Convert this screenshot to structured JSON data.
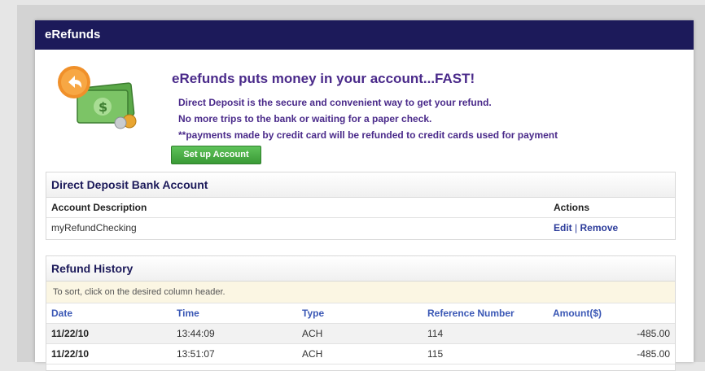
{
  "window": {
    "title": "eRefunds"
  },
  "promo": {
    "headline": "eRefunds puts money in your account...FAST!",
    "line1": "Direct Deposit is the secure and convenient way to get your refund.",
    "line2": "No more trips to the bank or waiting for a paper check.",
    "line3": "**payments made by credit card will be refunded to credit cards used for payment",
    "setup_button": "Set up Account",
    "icon": "money-refund-icon"
  },
  "bank_account": {
    "title": "Direct Deposit Bank Account",
    "col_description": "Account Description",
    "col_actions": "Actions",
    "rows": [
      {
        "description": "myRefundChecking",
        "edit": "Edit",
        "separator": "|",
        "remove": "Remove"
      }
    ]
  },
  "history": {
    "title": "Refund History",
    "sort_note": "To sort, click on the desired column header.",
    "columns": {
      "date": "Date",
      "time": "Time",
      "type": "Type",
      "reference": "Reference Number",
      "amount": "Amount($)"
    },
    "rows": [
      {
        "date": "11/22/10",
        "time": "13:44:09",
        "type": "ACH",
        "reference": "114",
        "amount": "-485.00"
      },
      {
        "date": "11/22/10",
        "time": "13:51:07",
        "type": "ACH",
        "reference": "115",
        "amount": "-485.00"
      }
    ]
  },
  "colors": {
    "titlebar": "#1c1a5a",
    "promo_text": "#4a2a8a",
    "button": "#3a9a36",
    "link": "#2b3b9a"
  }
}
